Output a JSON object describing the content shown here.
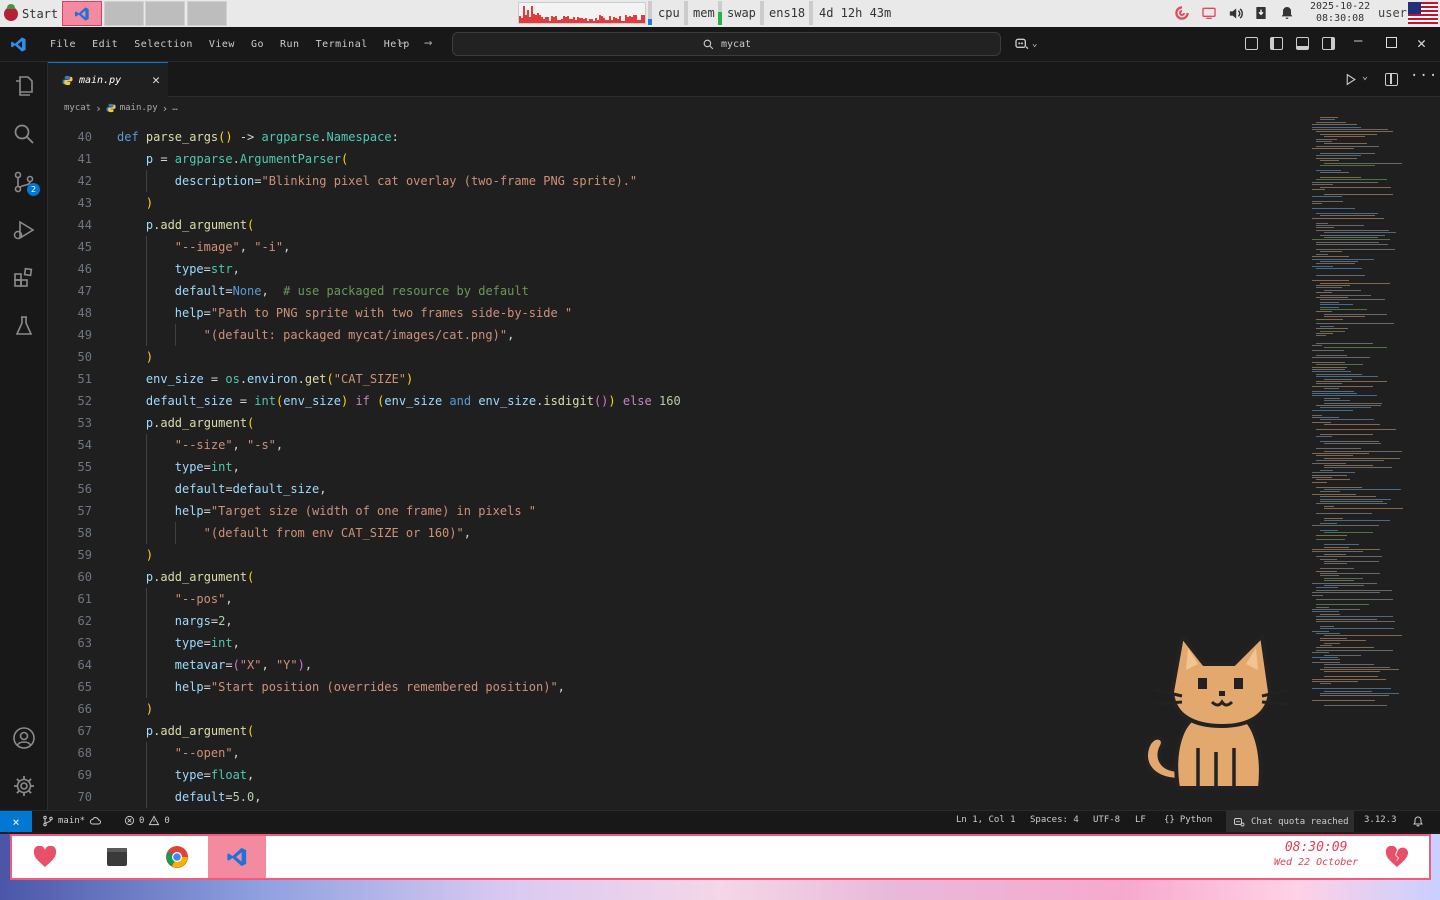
{
  "system_bar": {
    "start_label": "Start",
    "monitors": [
      {
        "label": "cpu",
        "level": 0.25,
        "color": "#1b7fd6"
      },
      {
        "label": "mem",
        "level": 0.55,
        "color": "#22b14c"
      },
      {
        "label": "swap",
        "level": 0.0,
        "color": "#999999"
      },
      {
        "label": "ens18",
        "level": 0.0,
        "color": "#999999"
      }
    ],
    "uptime": "4d 12h 43m",
    "date": "2025-10-22",
    "time": "08:30:08",
    "user": "user"
  },
  "menu": [
    "File",
    "Edit",
    "Selection",
    "View",
    "Go",
    "Run",
    "Terminal",
    "Help"
  ],
  "command_center": {
    "text": "mycat"
  },
  "tab": {
    "filename": "main.py",
    "close": "✕"
  },
  "breadcrumb": {
    "folder": "mycat",
    "file": "main.py",
    "more": "…"
  },
  "activity_badge": "2",
  "editor": {
    "lines": [
      {
        "n": "40",
        "indent": 0,
        "tokens": [
          [
            "kw",
            "def "
          ],
          [
            "fn",
            "parse_args"
          ],
          [
            "br",
            "()"
          ],
          [
            "pl",
            " -> "
          ],
          [
            "cls",
            "argparse"
          ],
          [
            "pl",
            "."
          ],
          [
            "cls",
            "Namespace"
          ],
          [
            "pl",
            ":"
          ]
        ]
      },
      {
        "n": "41",
        "indent": 1,
        "tokens": [
          [
            "param",
            "p"
          ],
          [
            "pl",
            " = "
          ],
          [
            "cls",
            "argparse"
          ],
          [
            "pl",
            "."
          ],
          [
            "cls",
            "ArgumentParser"
          ],
          [
            "br",
            "("
          ]
        ]
      },
      {
        "n": "42",
        "indent": 2,
        "tokens": [
          [
            "param",
            "description"
          ],
          [
            "pl",
            "="
          ],
          [
            "str",
            "\"Blinking pixel cat overlay (two-frame PNG sprite).\""
          ]
        ]
      },
      {
        "n": "43",
        "indent": 1,
        "tokens": [
          [
            "br",
            ")"
          ]
        ]
      },
      {
        "n": "44",
        "indent": 1,
        "tokens": [
          [
            "param",
            "p"
          ],
          [
            "pl",
            "."
          ],
          [
            "fn",
            "add_argument"
          ],
          [
            "br",
            "("
          ]
        ]
      },
      {
        "n": "45",
        "indent": 2,
        "tokens": [
          [
            "str",
            "\"--image\""
          ],
          [
            "pl",
            ", "
          ],
          [
            "str",
            "\"-i\""
          ],
          [
            "pl",
            ","
          ]
        ]
      },
      {
        "n": "46",
        "indent": 2,
        "tokens": [
          [
            "param",
            "type"
          ],
          [
            "pl",
            "="
          ],
          [
            "cls",
            "str"
          ],
          [
            "pl",
            ","
          ]
        ]
      },
      {
        "n": "47",
        "indent": 2,
        "tokens": [
          [
            "param",
            "default"
          ],
          [
            "pl",
            "="
          ],
          [
            "kw",
            "None"
          ],
          [
            "pl",
            ",  "
          ],
          [
            "cmt",
            "# use packaged resource by default"
          ]
        ]
      },
      {
        "n": "48",
        "indent": 2,
        "tokens": [
          [
            "param",
            "help"
          ],
          [
            "pl",
            "="
          ],
          [
            "str",
            "\"Path to PNG sprite with two frames side-by-side \""
          ]
        ]
      },
      {
        "n": "49",
        "indent": 3,
        "tokens": [
          [
            "str",
            "\"(default: packaged mycat/images/cat.png)\""
          ],
          [
            "pl",
            ","
          ]
        ]
      },
      {
        "n": "50",
        "indent": 1,
        "tokens": [
          [
            "br",
            ")"
          ]
        ]
      },
      {
        "n": "51",
        "indent": 1,
        "tokens": [
          [
            "param",
            "env_size"
          ],
          [
            "pl",
            " = "
          ],
          [
            "cls",
            "os"
          ],
          [
            "pl",
            "."
          ],
          [
            "param",
            "environ"
          ],
          [
            "pl",
            "."
          ],
          [
            "fn",
            "get"
          ],
          [
            "br",
            "("
          ],
          [
            "str",
            "\"CAT_SIZE\""
          ],
          [
            "br",
            ")"
          ]
        ]
      },
      {
        "n": "52",
        "indent": 1,
        "tokens": [
          [
            "param",
            "default_size"
          ],
          [
            "pl",
            " = "
          ],
          [
            "cls",
            "int"
          ],
          [
            "br",
            "("
          ],
          [
            "param",
            "env_size"
          ],
          [
            "br",
            ")"
          ],
          [
            "pl",
            " "
          ],
          [
            "kw2",
            "if"
          ],
          [
            "pl",
            " "
          ],
          [
            "br",
            "("
          ],
          [
            "param",
            "env_size "
          ],
          [
            "kw",
            "and"
          ],
          [
            "pl",
            " "
          ],
          [
            "param",
            "env_size"
          ],
          [
            "pl",
            "."
          ],
          [
            "fn",
            "isdigit"
          ],
          [
            "br2",
            "()"
          ],
          [
            "br",
            ")"
          ],
          [
            "pl",
            " "
          ],
          [
            "kw2",
            "else"
          ],
          [
            "pl",
            " "
          ],
          [
            "num",
            "160"
          ]
        ]
      },
      {
        "n": "53",
        "indent": 1,
        "tokens": [
          [
            "param",
            "p"
          ],
          [
            "pl",
            "."
          ],
          [
            "fn",
            "add_argument"
          ],
          [
            "br",
            "("
          ]
        ]
      },
      {
        "n": "54",
        "indent": 2,
        "tokens": [
          [
            "str",
            "\"--size\""
          ],
          [
            "pl",
            ", "
          ],
          [
            "str",
            "\"-s\""
          ],
          [
            "pl",
            ","
          ]
        ]
      },
      {
        "n": "55",
        "indent": 2,
        "tokens": [
          [
            "param",
            "type"
          ],
          [
            "pl",
            "="
          ],
          [
            "cls",
            "int"
          ],
          [
            "pl",
            ","
          ]
        ]
      },
      {
        "n": "56",
        "indent": 2,
        "tokens": [
          [
            "param",
            "default"
          ],
          [
            "pl",
            "="
          ],
          [
            "param",
            "default_size"
          ],
          [
            "pl",
            ","
          ]
        ]
      },
      {
        "n": "57",
        "indent": 2,
        "tokens": [
          [
            "param",
            "help"
          ],
          [
            "pl",
            "="
          ],
          [
            "str",
            "\"Target size (width of one frame) in pixels \""
          ]
        ]
      },
      {
        "n": "58",
        "indent": 3,
        "tokens": [
          [
            "str",
            "\"(default from env CAT_SIZE or 160)\""
          ],
          [
            "pl",
            ","
          ]
        ]
      },
      {
        "n": "59",
        "indent": 1,
        "tokens": [
          [
            "br",
            ")"
          ]
        ]
      },
      {
        "n": "60",
        "indent": 1,
        "tokens": [
          [
            "param",
            "p"
          ],
          [
            "pl",
            "."
          ],
          [
            "fn",
            "add_argument"
          ],
          [
            "br",
            "("
          ]
        ]
      },
      {
        "n": "61",
        "indent": 2,
        "tokens": [
          [
            "str",
            "\"--pos\""
          ],
          [
            "pl",
            ","
          ]
        ]
      },
      {
        "n": "62",
        "indent": 2,
        "tokens": [
          [
            "param",
            "nargs"
          ],
          [
            "pl",
            "="
          ],
          [
            "num",
            "2"
          ],
          [
            "pl",
            ","
          ]
        ]
      },
      {
        "n": "63",
        "indent": 2,
        "tokens": [
          [
            "param",
            "type"
          ],
          [
            "pl",
            "="
          ],
          [
            "cls",
            "int"
          ],
          [
            "pl",
            ","
          ]
        ]
      },
      {
        "n": "64",
        "indent": 2,
        "tokens": [
          [
            "param",
            "metavar"
          ],
          [
            "pl",
            "="
          ],
          [
            "br2",
            "("
          ],
          [
            "str",
            "\"X\""
          ],
          [
            "pl",
            ", "
          ],
          [
            "str",
            "\"Y\""
          ],
          [
            "br2",
            ")"
          ],
          [
            "pl",
            ","
          ]
        ]
      },
      {
        "n": "65",
        "indent": 2,
        "tokens": [
          [
            "param",
            "help"
          ],
          [
            "pl",
            "="
          ],
          [
            "str",
            "\"Start position (overrides remembered position)\""
          ],
          [
            "pl",
            ","
          ]
        ]
      },
      {
        "n": "66",
        "indent": 1,
        "tokens": [
          [
            "br",
            ")"
          ]
        ]
      },
      {
        "n": "67",
        "indent": 1,
        "tokens": [
          [
            "param",
            "p"
          ],
          [
            "pl",
            "."
          ],
          [
            "fn",
            "add_argument"
          ],
          [
            "br",
            "("
          ]
        ]
      },
      {
        "n": "68",
        "indent": 2,
        "tokens": [
          [
            "str",
            "\"--open\""
          ],
          [
            "pl",
            ","
          ]
        ]
      },
      {
        "n": "69",
        "indent": 2,
        "tokens": [
          [
            "param",
            "type"
          ],
          [
            "pl",
            "="
          ],
          [
            "cls",
            "float"
          ],
          [
            "pl",
            ","
          ]
        ]
      },
      {
        "n": "70",
        "indent": 2,
        "tokens": [
          [
            "param",
            "default"
          ],
          [
            "pl",
            "="
          ],
          [
            "num",
            "5.0"
          ],
          [
            "pl",
            ","
          ]
        ]
      }
    ]
  },
  "status_bar": {
    "branch": "main*",
    "errors": "0",
    "warnings": "0",
    "position": "Ln 1, Col 1",
    "spaces": "Spaces: 4",
    "encoding": "UTF-8",
    "eol": "LF",
    "language": "Python",
    "chat": "Chat quota reached",
    "version": "3.12.3"
  },
  "dock": {
    "time": "08:30:09",
    "date": "Wed 22 October"
  },
  "colors": {
    "accent": "#0078d4",
    "dock_border": "#f25c7a",
    "dock_active": "#f48aa0"
  }
}
